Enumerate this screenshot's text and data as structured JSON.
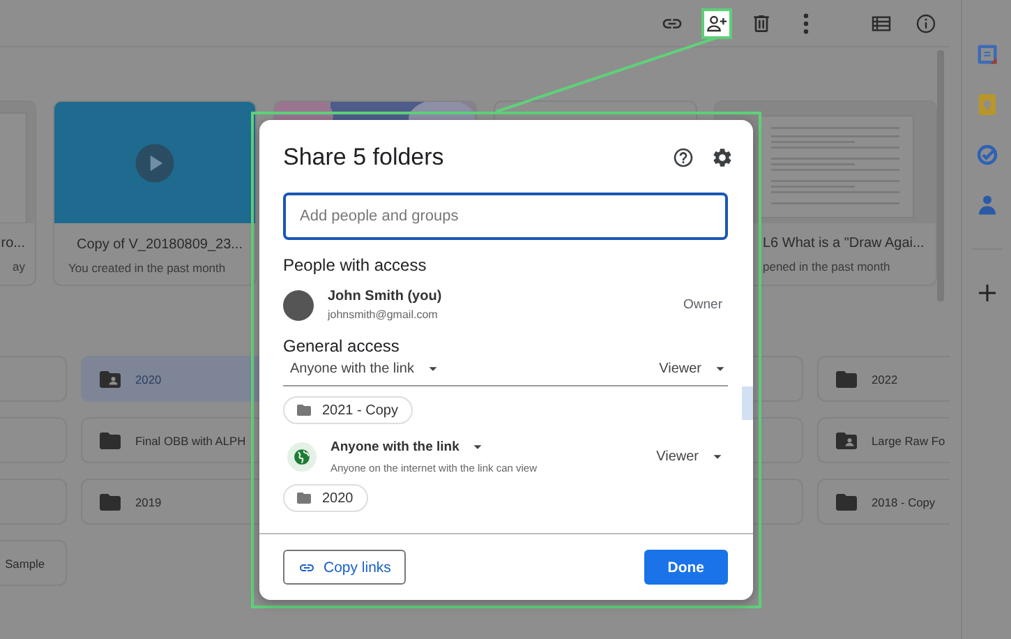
{
  "toolbar": {
    "icons": [
      {
        "kind": "link",
        "highlighted": false
      },
      {
        "kind": "share",
        "highlighted": true
      },
      {
        "kind": "trash",
        "highlighted": false
      },
      {
        "kind": "more",
        "highlighted": false
      },
      {
        "kind": "list",
        "highlighted": false
      },
      {
        "kind": "info",
        "highlighted": false
      }
    ]
  },
  "side_panel": {
    "icons": [
      {
        "kind": "calendar"
      },
      {
        "kind": "keep"
      },
      {
        "kind": "tasks"
      },
      {
        "kind": "contacts"
      },
      {
        "kind": "add"
      }
    ]
  },
  "suggested": [
    {
      "kind": "document",
      "title": "ro...",
      "subtitle": "ay"
    },
    {
      "kind": "video",
      "title": "Copy of V_20180809_23...",
      "subtitle": "You created in the past month"
    },
    {
      "kind": "picture"
    },
    {
      "kind": "blank"
    },
    {
      "kind": "document",
      "title": "L6 What is a \"Draw Agai...",
      "subtitle": "pened in the past month"
    }
  ],
  "folder_grid": {
    "rows": [
      {
        "cells": [
          {
            "selected": false
          },
          {
            "name": "2020",
            "kind": "shared",
            "selected": true
          },
          {
            "selected": false
          },
          {
            "name": "2022",
            "kind": "folder",
            "selected": false
          }
        ]
      },
      {
        "cells": [
          {
            "selected": false
          },
          {
            "name": "Final OBB with ALPH",
            "kind": "folder",
            "selected": false
          },
          {
            "selected": false
          },
          {
            "name": "Large Raw Fo",
            "kind": "shared",
            "selected": false
          }
        ]
      },
      {
        "cells": [
          {
            "selected": false
          },
          {
            "name": "2019",
            "kind": "folder",
            "selected": false
          },
          {
            "selected": false
          },
          {
            "name": "2018 - Copy",
            "kind": "folder",
            "selected": false
          }
        ]
      },
      {
        "cells": [
          {
            "name": "Sample",
            "selected": false
          }
        ]
      }
    ]
  },
  "share_dialog": {
    "title": "Share 5 folders",
    "search": {
      "placeholder": "Add people and groups"
    },
    "people_heading": "People with access",
    "people": [
      {
        "name": "John Smith (you)",
        "email": "johnsmith@gmail.com",
        "role": "Owner"
      }
    ],
    "general_heading": "General access",
    "general": {
      "access": "Anyone with the link",
      "role": "Viewer"
    },
    "items": [
      {
        "kind": "chip",
        "label": "2021 - Copy"
      },
      {
        "kind": "access",
        "access": "Anyone with the link",
        "description": "Anyone on the internet with the link can view",
        "role": "Viewer"
      },
      {
        "kind": "chip",
        "label": "2020"
      }
    ],
    "buttons": [
      {
        "kind": "outlined",
        "label": "Copy links"
      },
      {
        "kind": "primary",
        "label": "Done"
      }
    ]
  }
}
